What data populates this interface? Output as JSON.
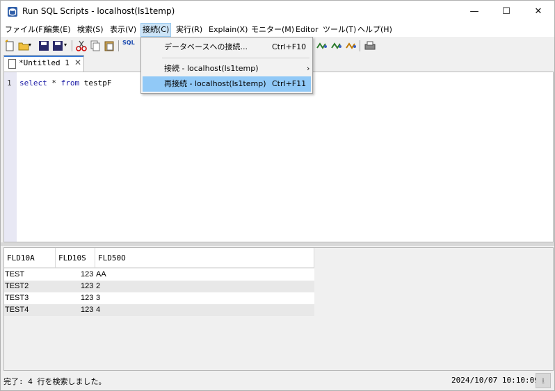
{
  "window": {
    "title": "Run SQL Scripts - localhost(ls1temp)"
  },
  "window_controls": {
    "minimize": "—",
    "maximize": "☐",
    "close": "✕"
  },
  "menu": {
    "file": "ファイル(F)",
    "edit": "編集(E)",
    "search": "検索(S)",
    "view": "表示(V)",
    "connection": "接続(C)",
    "run": "実行(R)",
    "explain": "Explain(X)",
    "monitor": "モニター(M)",
    "editor": "Editor",
    "tools": "ツール(T)",
    "help": "ヘルプ(H)"
  },
  "toolbar": {
    "sql_label": "SQL"
  },
  "connection_menu": {
    "items": [
      {
        "label": "データベースへの接続...",
        "shortcut": "Ctrl+F10"
      },
      {
        "label": "接続 - localhost(ls1temp)",
        "shortcut": "",
        "submenu": true
      },
      {
        "label": "再接続 - localhost(ls1temp)",
        "shortcut": "Ctrl+F11",
        "highlighted": true
      }
    ]
  },
  "tab": {
    "label": "*Untitled 1"
  },
  "editor": {
    "line_number": "1",
    "kw_select": "select",
    "star": " * ",
    "kw_from": "from",
    "table": " testpF"
  },
  "results": {
    "columns": [
      "FLD10A",
      "FLD10S",
      "FLD50O"
    ],
    "rows": [
      [
        "TEST",
        "123",
        "AA"
      ],
      [
        "TEST2",
        "123",
        "2"
      ],
      [
        "TEST3",
        "123",
        "3"
      ],
      [
        "TEST4",
        "123",
        "4"
      ]
    ]
  },
  "status": {
    "message": "完了: 4 行を検索しました。",
    "timestamp": "2024/10/07 10:10:09"
  },
  "colors": {
    "accent": "#3a7bd5",
    "menu_highlight": "#91c9f7",
    "keyword": "#1a1aa6"
  }
}
